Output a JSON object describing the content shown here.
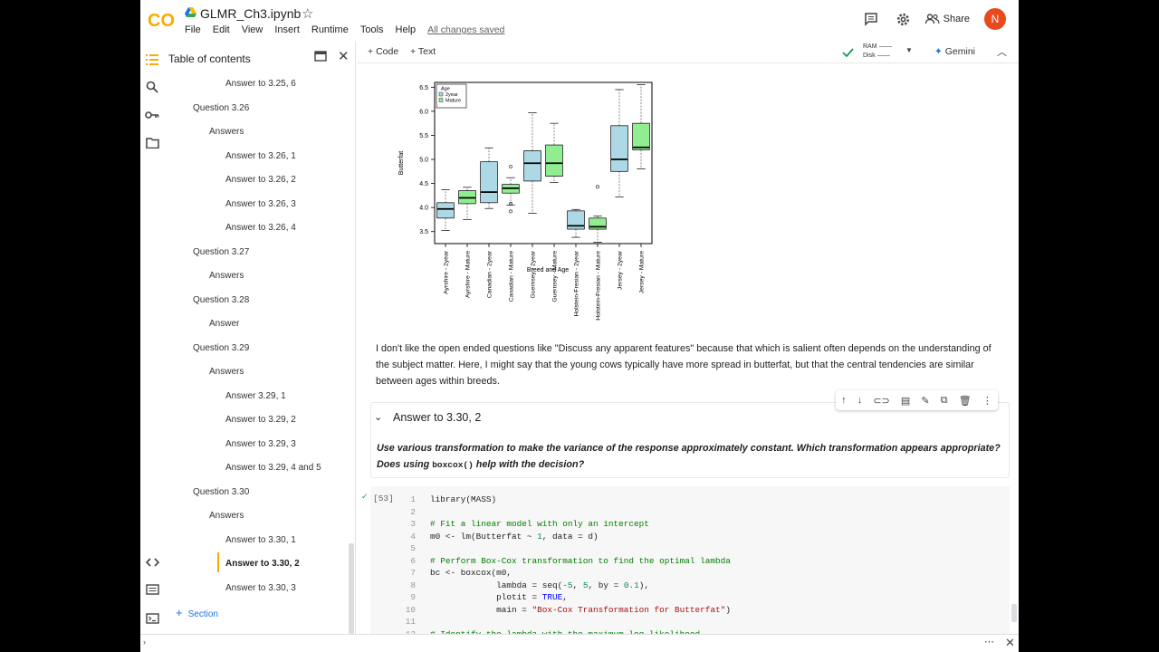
{
  "app": {
    "title": "GLMR_Ch3.ipynb",
    "menus": [
      "File",
      "Edit",
      "View",
      "Insert",
      "Runtime",
      "Tools",
      "Help"
    ],
    "saved_status": "All changes saved",
    "share_label": "Share",
    "avatar_letter": "N"
  },
  "toolbar": {
    "code_label": "Code",
    "text_label": "Text",
    "ram_label": "RAM",
    "disk_label": "Disk",
    "gemini_label": "Gemini"
  },
  "toc": {
    "title": "Table of contents",
    "items": [
      {
        "label": "Answer to 3.25, 6",
        "level": 3
      },
      {
        "label": "Question 3.26",
        "level": 1
      },
      {
        "label": "Answers",
        "level": 2
      },
      {
        "label": "Answer to 3.26, 1",
        "level": 3
      },
      {
        "label": "Answer to 3.26, 2",
        "level": 3
      },
      {
        "label": "Answer to 3.26, 3",
        "level": 3
      },
      {
        "label": "Answer to 3.26, 4",
        "level": 3
      },
      {
        "label": "Question 3.27",
        "level": 1
      },
      {
        "label": "Answers",
        "level": 2
      },
      {
        "label": "Question 3.28",
        "level": 1
      },
      {
        "label": "Answer",
        "level": 2
      },
      {
        "label": "Question 3.29",
        "level": 1
      },
      {
        "label": "Answers",
        "level": 2
      },
      {
        "label": "Answer 3.29, 1",
        "level": 3
      },
      {
        "label": "Answer to 3.29, 2",
        "level": 3
      },
      {
        "label": "Answer to 3.29, 3",
        "level": 3
      },
      {
        "label": "Answer to 3.29, 4 and 5",
        "level": 3
      },
      {
        "label": "Question 3.30",
        "level": 1
      },
      {
        "label": "Answers",
        "level": 2
      },
      {
        "label": "Answer to 3.30, 1",
        "level": 3
      },
      {
        "label": "Answer to 3.30, 2",
        "level": 3,
        "active": true
      },
      {
        "label": "Answer to 3.30, 3",
        "level": 3
      }
    ],
    "section_label": "Section"
  },
  "chart_data": {
    "type": "boxplot",
    "xlabel": "Breed and Age",
    "ylabel": "Butterfat",
    "ylim": [
      3.25,
      6.6
    ],
    "yticks": [
      3.5,
      4.0,
      4.5,
      5.0,
      5.5,
      6.0,
      6.5
    ],
    "legend": {
      "title": "Age",
      "entries": [
        {
          "label": "2year",
          "color": "#add8e6"
        },
        {
          "label": "Mature",
          "color": "#90ee90"
        }
      ],
      "position": "top-left"
    },
    "categories": [
      "Ayrshire - 2year",
      "Ayrshire - Mature",
      "Canadian - 2year",
      "Canadian - Mature",
      "Guernsey - 2year",
      "Guernsey - Mature",
      "Holstein-Fresian - 2year",
      "Holstein-Fresian - Mature",
      "Jersey - 2year",
      "Jersey - Mature"
    ],
    "boxes": [
      {
        "min": 3.52,
        "q1": 3.78,
        "median": 3.97,
        "q3": 4.1,
        "max": 4.37,
        "outliers": [],
        "color": "#add8e6"
      },
      {
        "min": 3.75,
        "q1": 4.08,
        "median": 4.2,
        "q3": 4.35,
        "max": 4.42,
        "outliers": [],
        "color": "#90ee90"
      },
      {
        "min": 3.98,
        "q1": 4.1,
        "median": 4.32,
        "q3": 4.95,
        "max": 5.24,
        "outliers": [],
        "color": "#add8e6"
      },
      {
        "min": 4.05,
        "q1": 4.3,
        "median": 4.4,
        "q3": 4.48,
        "max": 4.62,
        "outliers": [
          4.85,
          4.08,
          3.92
        ],
        "color": "#90ee90"
      },
      {
        "min": 3.88,
        "q1": 4.55,
        "median": 4.92,
        "q3": 5.18,
        "max": 5.97,
        "outliers": [],
        "color": "#add8e6"
      },
      {
        "min": 4.52,
        "q1": 4.65,
        "median": 4.92,
        "q3": 5.3,
        "max": 5.75,
        "outliers": [],
        "color": "#90ee90"
      },
      {
        "min": 3.38,
        "q1": 3.55,
        "median": 3.62,
        "q3": 3.93,
        "max": 3.96,
        "outliers": [],
        "color": "#add8e6"
      },
      {
        "min": 3.28,
        "q1": 3.55,
        "median": 3.6,
        "q3": 3.78,
        "max": 3.82,
        "outliers": [
          4.43
        ],
        "color": "#90ee90"
      },
      {
        "min": 4.22,
        "q1": 4.75,
        "median": 5.0,
        "q3": 5.7,
        "max": 6.45,
        "outliers": [],
        "color": "#add8e6"
      },
      {
        "min": 4.8,
        "q1": 5.2,
        "median": 5.25,
        "q3": 5.75,
        "max": 6.55,
        "outliers": [],
        "color": "#90ee90"
      }
    ]
  },
  "markdown_text": "I don't like the open ended questions like \"Discuss any apparent features\" because that which is salient often depends on the understanding of the subject matter. Here, I might say that the young cows typically have more spread in butterfat, but that the central tendencies are similar between ages within breeds.",
  "heading_cell": {
    "title": "Answer to 3.30, 2",
    "body_before": "Use various transformation to make the variance of the response approximately constant. Which transformation appears appropriate? Does using ",
    "body_code": "boxcox()",
    "body_after": " help with the decision?"
  },
  "code_cell": {
    "exec_count": "[53]",
    "lines": [
      "library(MASS)",
      "",
      "# Fit a linear model with only an intercept",
      "m0 <- lm(Butterfat ~ 1, data = d)",
      "",
      "# Perform Box-Cox transformation to find the optimal lambda",
      "bc <- boxcox(m0,",
      "             lambda = seq(-5, 5, by = 0.1),",
      "             plotit = TRUE,",
      "             main = \"Box-Cox Transformation for Butterfat\")",
      "",
      "# Identify the lambda with the maximum log-likelihood"
    ]
  },
  "colors": {
    "accent": "#1a73e8",
    "active_marker": "#f9ab00",
    "logo_orange": "#f9ab00",
    "avatar": "#e8491d",
    "run_ok": "#0f9d58"
  }
}
